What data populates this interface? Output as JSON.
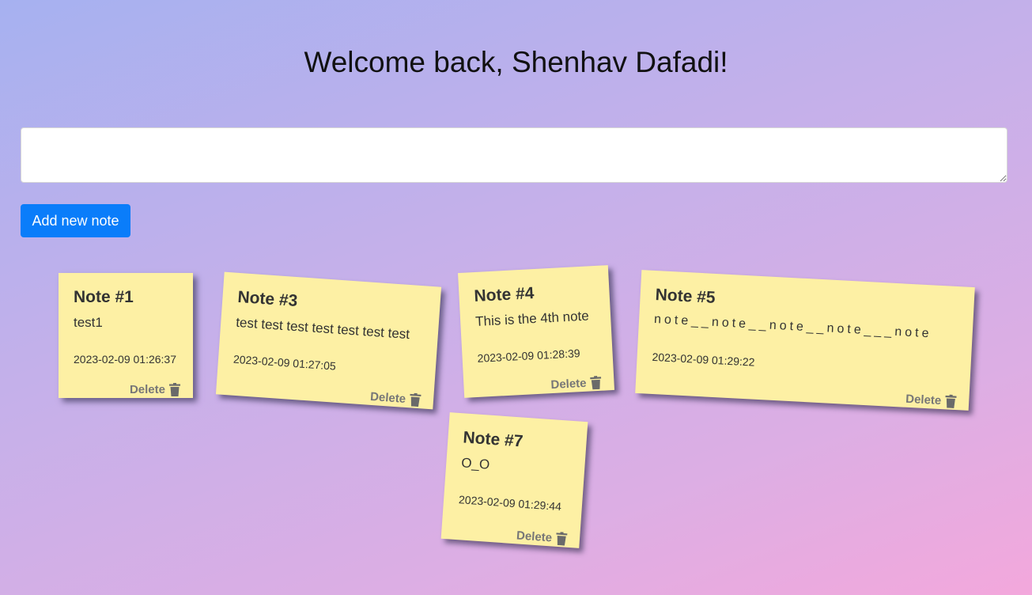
{
  "header": {
    "title": "Welcome back, Shenhav Dafadi!"
  },
  "composer": {
    "value": "",
    "add_button_label": "Add new note"
  },
  "notes": [
    {
      "title": "Note #1",
      "body": "test1",
      "date": "2023-02-09 01:26:37",
      "delete_label": "Delete"
    },
    {
      "title": "Note #3",
      "body": "test test test test test test test",
      "date": "2023-02-09 01:27:05",
      "delete_label": "Delete"
    },
    {
      "title": "Note #4",
      "body": "This is the 4th note",
      "date": "2023-02-09 01:28:39",
      "delete_label": "Delete"
    },
    {
      "title": "Note #5",
      "body": "note__note__note__note___note",
      "date": "2023-02-09 01:29:22",
      "delete_label": "Delete"
    },
    {
      "title": "Note #7",
      "body": "O_O",
      "date": "2023-02-09 01:29:44",
      "delete_label": "Delete"
    }
  ],
  "icons": {
    "delete": "trash-icon"
  },
  "colors": {
    "accent": "#0a7dfa",
    "note": "#fdf0a4"
  }
}
